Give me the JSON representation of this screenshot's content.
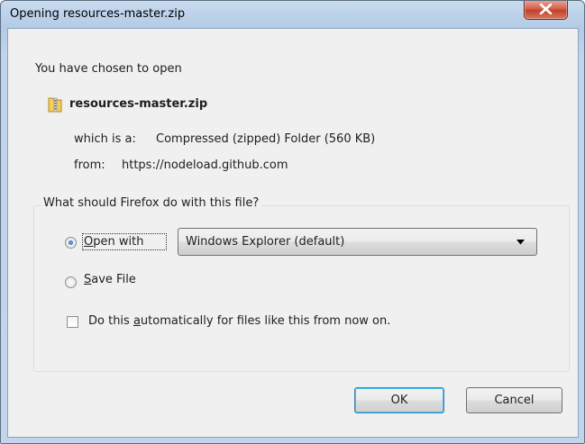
{
  "window": {
    "title": "Opening resources-master.zip"
  },
  "content": {
    "intro": "You have chosen to open",
    "file_name": "resources-master.zip",
    "which_is_label": "which is a:",
    "which_is_value": "Compressed (zipped) Folder (560 KB)",
    "from_label": "from:",
    "from_value": "https://nodeload.github.com"
  },
  "action_group": {
    "legend": "What should Firefox do with this file?",
    "open_with": {
      "mnemonic": "O",
      "rest": "pen with",
      "selected": true
    },
    "app_select": {
      "value": "Windows Explorer (default)"
    },
    "save_file": {
      "mnemonic": "S",
      "rest": "ave File",
      "selected": false
    },
    "auto_checkbox": {
      "before": "Do this ",
      "mnemonic": "a",
      "after": "utomatically for files like this from now on.",
      "checked": false
    }
  },
  "buttons": {
    "ok": "OK",
    "cancel": "Cancel"
  },
  "icons": {
    "file": "zip-folder-icon",
    "close": "close-icon",
    "dropdown": "chevron-down-icon"
  },
  "colors": {
    "titlebar": "#b9d1ea",
    "close_button": "#c7432c",
    "dialog_bg": "#f0f0f0",
    "focus_border": "#3c7fb1"
  }
}
